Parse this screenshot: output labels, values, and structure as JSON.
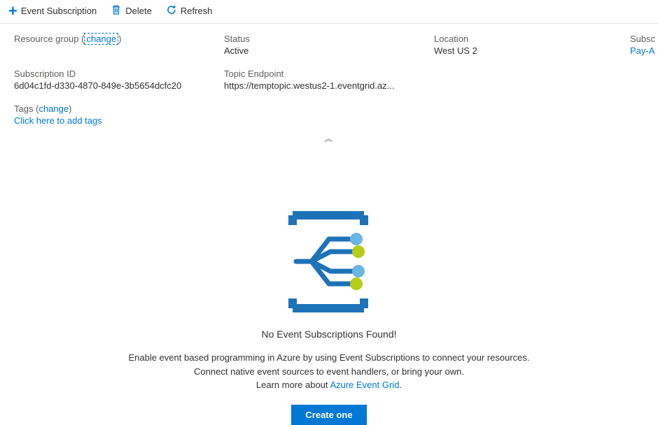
{
  "toolbar": {
    "event_subscription_label": "Event Subscription",
    "delete_label": "Delete",
    "refresh_label": "Refresh"
  },
  "essentials": {
    "resource_group": {
      "label": "Resource group",
      "change_label": "change"
    },
    "status": {
      "label": "Status",
      "value": "Active"
    },
    "location": {
      "label": "Location",
      "value": "West US 2"
    },
    "subscription_right": {
      "label": "Subsc",
      "value": "Pay-A"
    },
    "subscription_id": {
      "label": "Subscription ID",
      "value": "6d04c1fd-d330-4870-849e-3b5654dcfc20"
    },
    "topic_endpoint": {
      "label": "Topic Endpoint",
      "value": "https://temptopic.westus2-1.eventgrid.az..."
    },
    "tags": {
      "label": "Tags",
      "change_label": "change",
      "add_link": "Click here to add tags"
    }
  },
  "empty": {
    "title": "No Event Subscriptions Found!",
    "desc1": "Enable event based programming in Azure by using Event Subscriptions to connect your resources.",
    "desc2": "Connect native event sources to event handlers, or bring your own.",
    "desc3_prefix": "Learn more about ",
    "desc3_link": "Azure Event Grid",
    "desc3_suffix": ".",
    "create_button": "Create one"
  },
  "collapse": {
    "glyph": "︽"
  }
}
